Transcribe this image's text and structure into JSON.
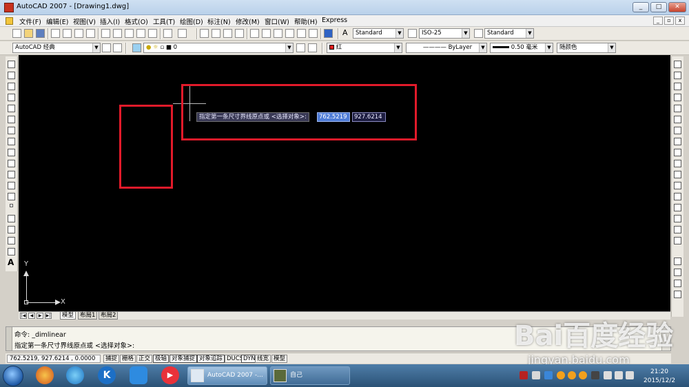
{
  "window": {
    "title": "AutoCAD 2007 - [Drawing1.dwg]",
    "buttons": [
      "_",
      "□",
      "✕"
    ]
  },
  "menu": {
    "items": [
      "文件(F)",
      "编辑(E)",
      "视图(V)",
      "插入(I)",
      "格式(O)",
      "工具(T)",
      "绘图(D)",
      "标注(N)",
      "修改(M)",
      "窗口(W)",
      "帮助(H)",
      "Express"
    ]
  },
  "toolbar1": {
    "text_style": "Standard",
    "dim_style": "ISO-25",
    "table_style": "Standard"
  },
  "toolbar2": {
    "workspace": "AutoCAD 经典",
    "layer": "0",
    "color": "红",
    "linetype": "ByLayer",
    "lineweight": "0.50 毫米",
    "plot_style": "随颜色"
  },
  "dynamic_input": {
    "prompt": "指定第一条尺寸界线原点或 <选择对象>:",
    "x_value": "762.5219",
    "y_value": "927.6214"
  },
  "ucs": {
    "x_label": "X",
    "y_label": "Y"
  },
  "layout_tabs": [
    "模型",
    "布局1",
    "布局2"
  ],
  "nav_buttons": [
    "|◀",
    "◀",
    "▶",
    "▶|"
  ],
  "command": {
    "line1": "命令: _dimlinear",
    "line2": "指定第一条尺寸界线原点或 <选择对象>:"
  },
  "status": {
    "coords": "762.5219,  927.6214 , 0.0000",
    "toggles": [
      "捕捉",
      "栅格",
      "正交",
      "极轴",
      "对象捕捉",
      "对象追踪",
      "DUCS",
      "DYN",
      "线宽",
      "模型"
    ]
  },
  "taskbar": {
    "tasks": [
      "AutoCAD 2007 -...",
      "自己"
    ],
    "time": "21:20",
    "date": "2015/12/2"
  },
  "watermark": {
    "brand": "Bai百度经验",
    "url": "jingyan.baidu.com"
  },
  "colors": {
    "canvas": "#000000",
    "highlight_box": "#e21a2a",
    "dyn_value_selected": "#4f7cd6"
  }
}
